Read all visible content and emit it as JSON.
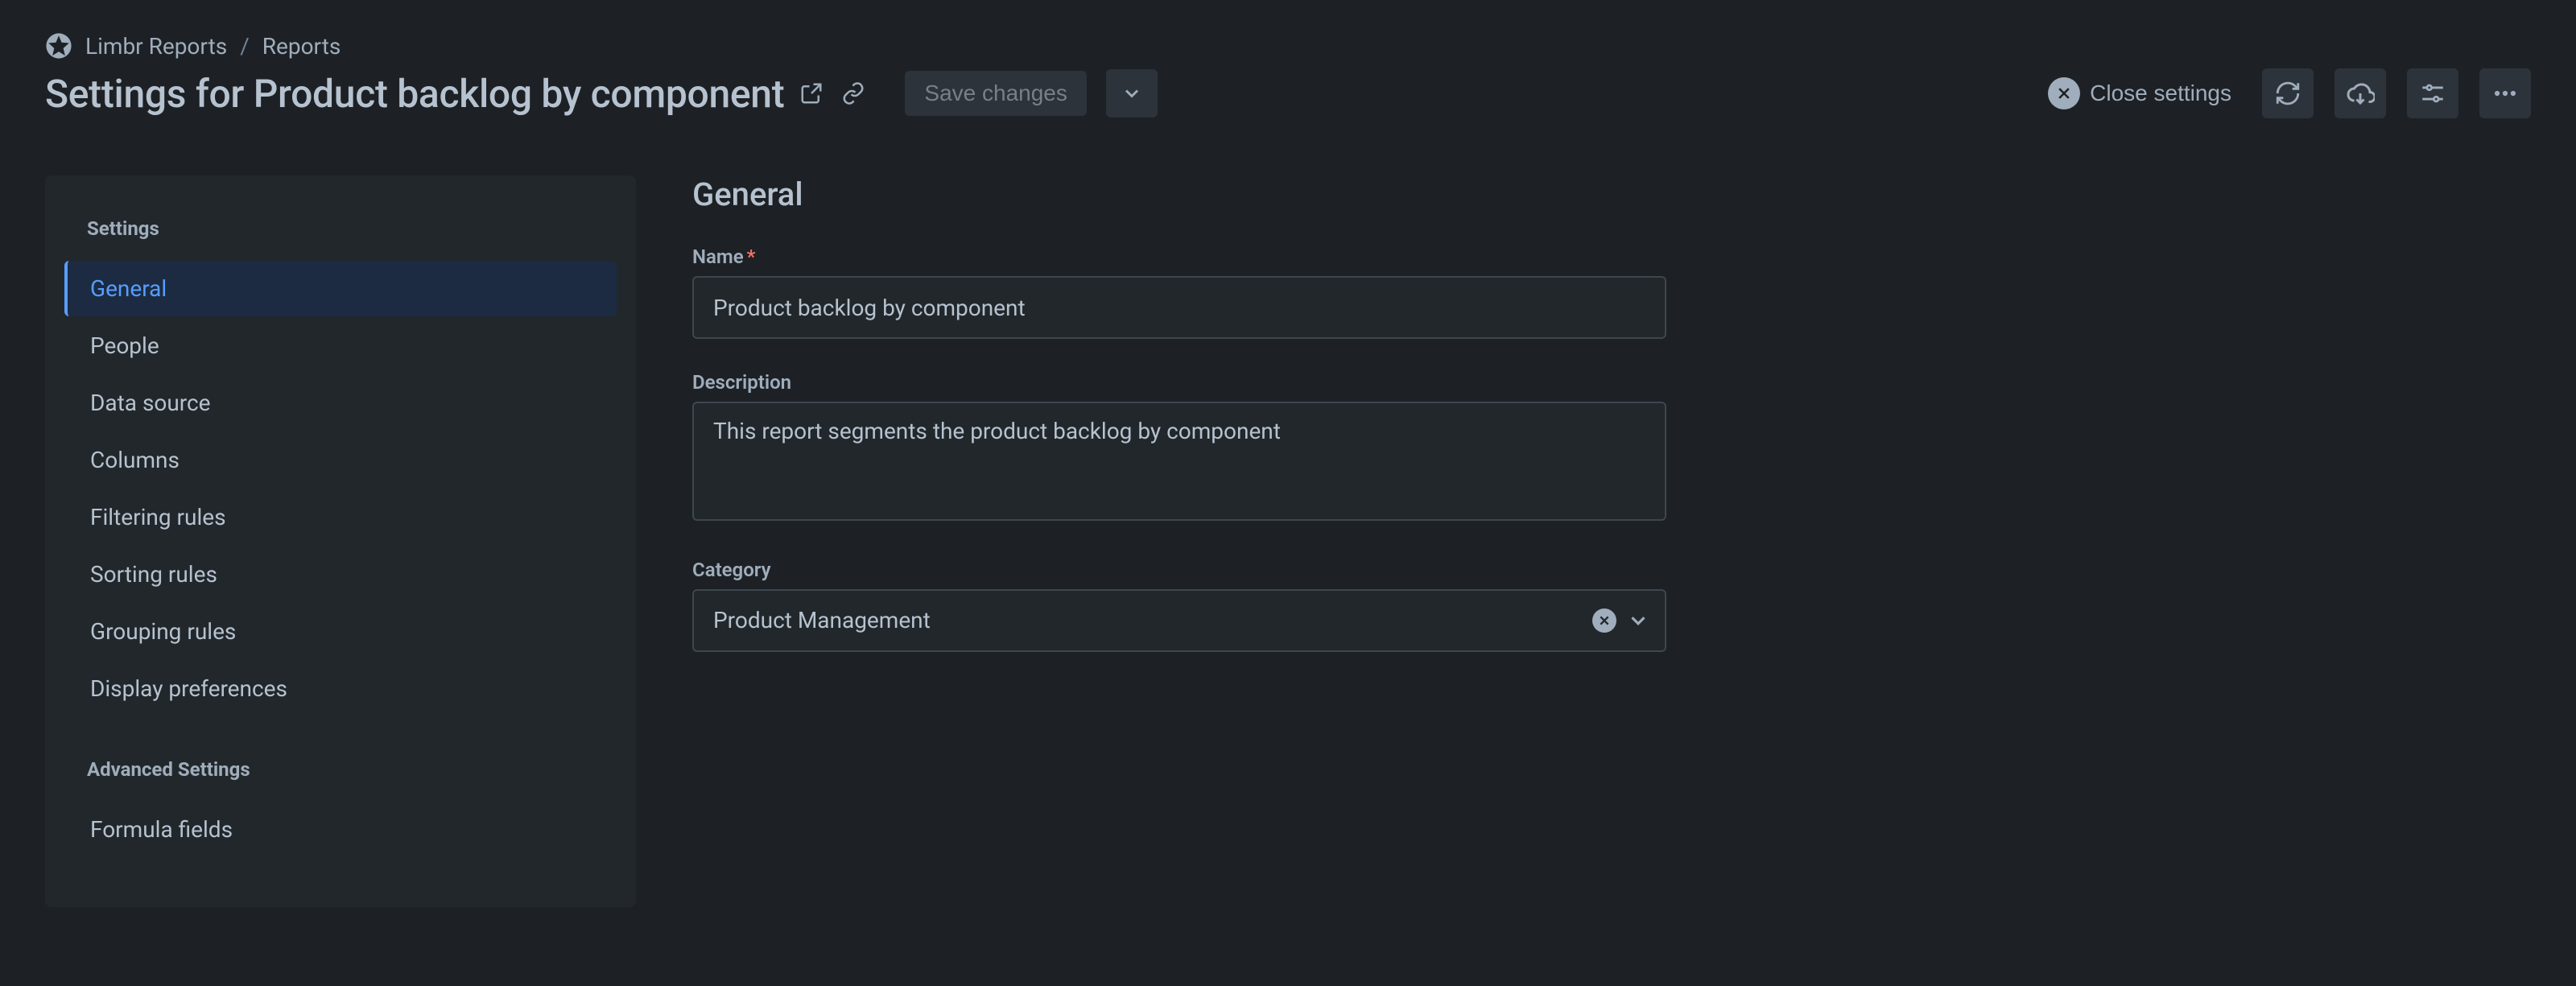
{
  "breadcrumb": {
    "app": "Limbr Reports",
    "section": "Reports"
  },
  "header": {
    "title": "Settings for Product backlog by component",
    "save_label": "Save changes",
    "close_label": "Close settings"
  },
  "sidebar": {
    "heading_settings": "Settings",
    "heading_advanced": "Advanced Settings",
    "items": [
      {
        "label": "General"
      },
      {
        "label": "People"
      },
      {
        "label": "Data source"
      },
      {
        "label": "Columns"
      },
      {
        "label": "Filtering rules"
      },
      {
        "label": "Sorting rules"
      },
      {
        "label": "Grouping rules"
      },
      {
        "label": "Display preferences"
      }
    ],
    "advanced_items": [
      {
        "label": "Formula fields"
      }
    ]
  },
  "main": {
    "section_title": "General",
    "name_label": "Name",
    "name_value": "Product backlog by component",
    "description_label": "Description",
    "description_value": "This report segments the product backlog by component",
    "category_label": "Category",
    "category_value": "Product Management"
  }
}
